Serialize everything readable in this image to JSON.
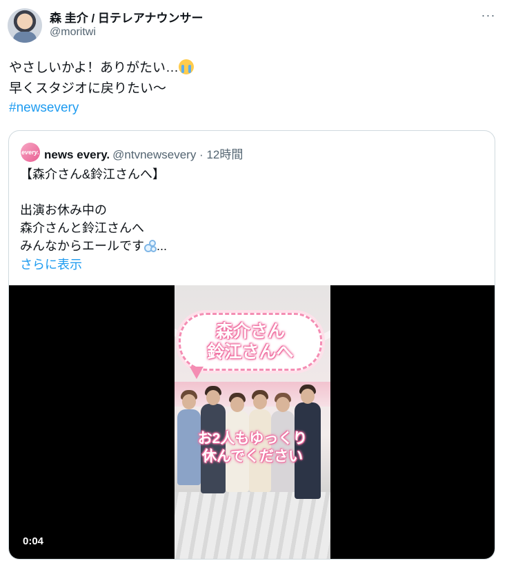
{
  "tweet": {
    "display_name": "森 圭介 / 日テレアナウンサー",
    "handle": "@moritwi",
    "text": "やさしいかよ！ありがたい…",
    "text_line2": "早くスタジオに戻りたい〜",
    "hashtag": "#newsevery"
  },
  "quote": {
    "avatar_label": "every.",
    "name": "news every.",
    "meta": "@ntvnewsevery · 12時間",
    "text": "【森介さん&鈴江さんへ】\n\n出演お休み中の\n森介さんと鈴江さんへ\nみんなからエールです",
    "ellipsis": "...",
    "more_link": "さらに表示"
  },
  "video": {
    "bubble_text": "森介さん\n鈴江さんへ",
    "caption": "お2人もゆっくり\n休んでください",
    "time": "0:04"
  },
  "icons": {
    "avatar": "profile-photo",
    "more": "more-options-icon",
    "emoji": "loudly-crying-face-emoji",
    "bubbles": "bubbles-emoji"
  }
}
